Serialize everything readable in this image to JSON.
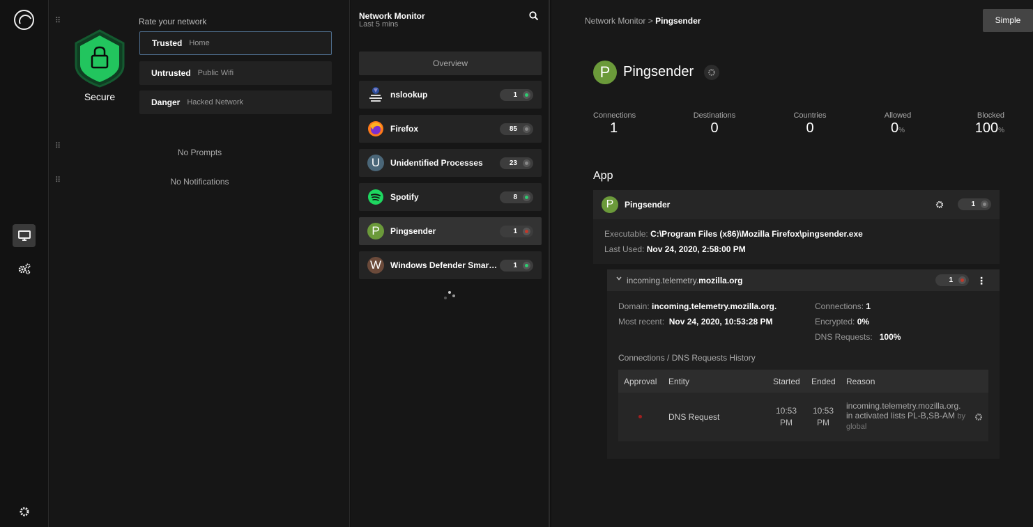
{
  "status_panel": {
    "secure_label": "Secure",
    "rate_title": "Rate your network",
    "options": [
      {
        "name": "Trusted",
        "desc": "Home"
      },
      {
        "name": "Untrusted",
        "desc": "Public Wifi"
      },
      {
        "name": "Danger",
        "desc": "Hacked Network"
      }
    ],
    "no_prompts": "No Prompts",
    "no_notifications": "No Notifications",
    "shield_color": "#22c55e"
  },
  "list_panel": {
    "title": "Network Monitor",
    "subtitle": "Last 5 mins",
    "overview_label": "Overview",
    "processes": [
      {
        "name": "nslookup",
        "count": "1",
        "status": "#2ecc71",
        "icon": "nslookup-icon"
      },
      {
        "name": "Firefox",
        "count": "85",
        "status": "#888888",
        "icon": "firefox-icon"
      },
      {
        "name": "Unidentified Processes",
        "count": "23",
        "status": "#888888",
        "icon": "U",
        "icon_color": "#4a6678"
      },
      {
        "name": "Spotify",
        "count": "8",
        "status": "#2ecc71",
        "icon": "spotify-icon"
      },
      {
        "name": "Pingsender",
        "count": "1",
        "status": "#c0392b",
        "icon": "P",
        "icon_color": "#6b9a3a"
      },
      {
        "name": "Windows Defender SmartS...",
        "count": "1",
        "status": "#2ecc71",
        "icon": "W",
        "icon_color": "#6b4a3a"
      }
    ]
  },
  "detail": {
    "breadcrumb_root": "Network Monitor",
    "breadcrumb_sep": ">",
    "breadcrumb_current": "Pingsender",
    "simple_button": "Simple",
    "avatar_letter": "P",
    "app_title": "Pingsender",
    "stats": [
      {
        "label": "Connections",
        "value": "1",
        "unit": ""
      },
      {
        "label": "Destinations",
        "value": "0",
        "unit": ""
      },
      {
        "label": "Countries",
        "value": "0",
        "unit": ""
      },
      {
        "label": "Allowed",
        "value": "0",
        "unit": "%"
      },
      {
        "label": "Blocked",
        "value": "100",
        "unit": "%"
      }
    ],
    "section_title": "App",
    "app_card": {
      "avatar_letter": "P",
      "name": "Pingsender",
      "count": "1",
      "executable_label": "Executable:",
      "executable_value": "C:\\Program Files (x86)\\Mozilla Firefox\\pingsender.exe",
      "last_used_label": "Last Used:",
      "last_used_value": "Nov 24, 2020, 2:58:00 PM"
    },
    "domain_card": {
      "name_prefix": "incoming.telemetry.",
      "name_domain": "mozilla.org",
      "count": "1",
      "domain_label": "Domain:",
      "domain_value": "incoming.telemetry.mozilla.org.",
      "most_recent_label": "Most recent:",
      "most_recent_value": "Nov 24, 2020, 10:53:28 PM",
      "connections_label": "Connections:",
      "connections_value": "1",
      "encrypted_label": "Encrypted:",
      "encrypted_value": "0%",
      "dns_label": "DNS Requests:",
      "dns_value": "100%",
      "history_title": "Connections / DNS Requests History",
      "table": {
        "headers": [
          "Approval",
          "Entity",
          "Started",
          "Ended",
          "Reason"
        ],
        "rows": [
          {
            "entity": "DNS Request",
            "started_1": "10:53",
            "started_2": "PM",
            "ended_1": "10:53",
            "ended_2": "PM",
            "reason_line1": "incoming.telemetry.mozilla.org.",
            "reason_line2": "in activated lists PL-B,SB-AM",
            "reason_by": "by",
            "reason_line3": "global"
          }
        ]
      }
    }
  }
}
